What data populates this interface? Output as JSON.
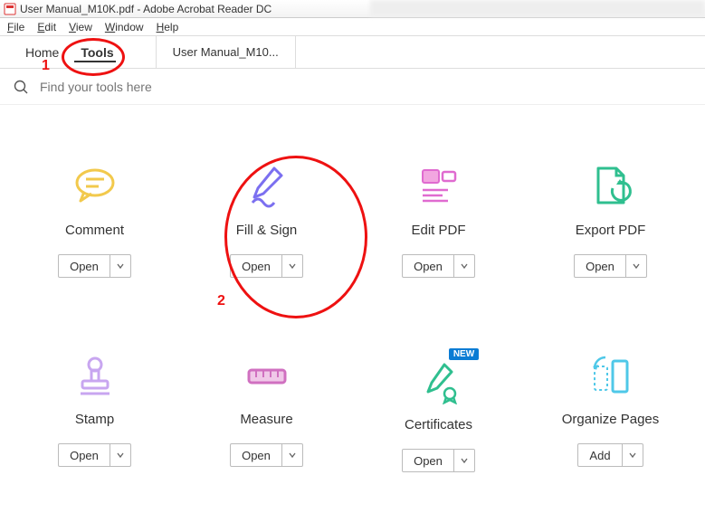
{
  "titlebar": {
    "text": "User Manual_M10K.pdf - Adobe Acrobat Reader DC"
  },
  "menu": {
    "file": "File",
    "edit": "Edit",
    "view": "View",
    "window": "Window",
    "help": "Help"
  },
  "tabs": {
    "home": "Home",
    "tools": "Tools",
    "doc": "User Manual_M10..."
  },
  "search": {
    "placeholder": "Find your tools here"
  },
  "actions": {
    "open": "Open",
    "add": "Add"
  },
  "badges": {
    "new": "NEW"
  },
  "tools": {
    "comment": "Comment",
    "fillsign": "Fill & Sign",
    "editpdf": "Edit PDF",
    "exportpdf": "Export PDF",
    "stamp": "Stamp",
    "measure": "Measure",
    "certificates": "Certificates",
    "organize": "Organize Pages"
  },
  "annotations": {
    "one": "1",
    "two": "2"
  }
}
